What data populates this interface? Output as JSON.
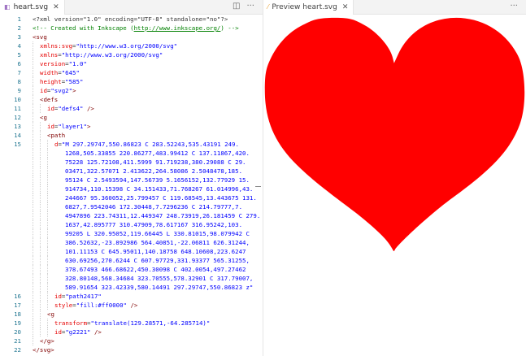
{
  "editor": {
    "tab_label": "heart.svg",
    "tab_icon": "svg-file-icon",
    "close_glyph": "✕",
    "split_glyph": "◫",
    "more_glyph": "···",
    "lines": [
      {
        "n": "1",
        "segs": [
          [
            "plain",
            "<?xml version=\"1.0\" encoding=\"UTF-8\" standalone=\"no\"?>"
          ]
        ]
      },
      {
        "n": "2",
        "segs": [
          [
            "cmt",
            "<!-- Created with Inkscape ("
          ],
          [
            "cmt link",
            "http://www.inkscape.org/"
          ],
          [
            "cmt",
            ") -->"
          ]
        ]
      },
      {
        "n": "3",
        "segs": [
          [
            "tag",
            "<svg"
          ]
        ]
      },
      {
        "n": "4",
        "segs": [
          [
            "attr",
            "xmlns:svg"
          ],
          [
            "plain",
            "="
          ],
          [
            "str",
            "\"http://www.w3.org/2000/svg\""
          ]
        ]
      },
      {
        "n": "5",
        "segs": [
          [
            "attr",
            "xmlns"
          ],
          [
            "plain",
            "="
          ],
          [
            "str",
            "\"http://www.w3.org/2000/svg\""
          ]
        ]
      },
      {
        "n": "6",
        "segs": [
          [
            "attr",
            "version"
          ],
          [
            "plain",
            "="
          ],
          [
            "str",
            "\"1.0\""
          ]
        ]
      },
      {
        "n": "7",
        "segs": [
          [
            "attr",
            "width"
          ],
          [
            "plain",
            "="
          ],
          [
            "str",
            "\"645\""
          ]
        ]
      },
      {
        "n": "8",
        "segs": [
          [
            "attr",
            "height"
          ],
          [
            "plain",
            "="
          ],
          [
            "str",
            "\"585\""
          ]
        ]
      },
      {
        "n": "9",
        "segs": [
          [
            "attr",
            "id"
          ],
          [
            "plain",
            "="
          ],
          [
            "str",
            "\"svg2\""
          ],
          [
            "tag",
            ">"
          ]
        ]
      },
      {
        "n": "10",
        "segs": [
          [
            "tag",
            "<defs"
          ]
        ]
      },
      {
        "n": "11",
        "segs": [
          [
            "attr",
            "id"
          ],
          [
            "plain",
            "="
          ],
          [
            "str",
            "\"defs4\""
          ],
          [
            "tag",
            " />"
          ]
        ]
      },
      {
        "n": "12",
        "segs": [
          [
            "tag",
            "<g"
          ]
        ]
      },
      {
        "n": "13",
        "segs": [
          [
            "attr",
            "id"
          ],
          [
            "plain",
            "="
          ],
          [
            "str",
            "\"layer1\""
          ],
          [
            "tag",
            ">"
          ]
        ]
      },
      {
        "n": "14",
        "segs": [
          [
            "tag",
            "<path"
          ]
        ]
      },
      {
        "n": "15",
        "segs": [
          [
            "attr",
            "d"
          ],
          [
            "plain",
            "="
          ],
          [
            "str",
            "\"M 297.29747,550.86823 C 283.52243,535.43191 249."
          ]
        ]
      },
      {
        "n": "",
        "segs": [
          [
            "str",
            "1268,505.33855 220.86277,483.99412 C 137.11867,420."
          ]
        ]
      },
      {
        "n": "",
        "segs": [
          [
            "str",
            "75228 125.72108,411.5999 91.719238,380.29088 C 29."
          ]
        ]
      },
      {
        "n": "",
        "segs": [
          [
            "str",
            "03471,322.57071 2.413622,264.58086 2.5048478,185."
          ]
        ]
      },
      {
        "n": "",
        "segs": [
          [
            "str",
            "95124 C 2.5493594,147.56739 5.1656152,132.77929 15."
          ]
        ]
      },
      {
        "n": "",
        "segs": [
          [
            "str",
            "914734,110.15398 C 34.151433,71.768267 61.014996,43."
          ]
        ]
      },
      {
        "n": "",
        "segs": [
          [
            "str",
            "244667 95.360052,25.799457 C 119.68545,13.443675 131."
          ]
        ]
      },
      {
        "n": "",
        "segs": [
          [
            "str",
            "6827,7.9542046 172.30448,7.7296236 C 214.79777,7."
          ]
        ]
      },
      {
        "n": "",
        "segs": [
          [
            "str",
            "4947896 223.74311,12.449347 248.73919,26.181459 C 279."
          ]
        ]
      },
      {
        "n": "",
        "segs": [
          [
            "str",
            "1637,42.895777 310.47909,78.617167 316.95242,103."
          ]
        ]
      },
      {
        "n": "",
        "segs": [
          [
            "str",
            "99205 L 320.95052,119.66445 L 330.81015,98.079942 C"
          ]
        ]
      },
      {
        "n": "",
        "segs": [
          [
            "str",
            "386.52632,-23.892986 564.40851,-22.06811 626.31244,"
          ]
        ]
      },
      {
        "n": "",
        "segs": [
          [
            "str",
            "101.11153 C 645.95011,140.18758 648.10608,223.6247"
          ]
        ]
      },
      {
        "n": "",
        "segs": [
          [
            "str",
            "630.69256,270.6244 C 607.97729,331.93377 565.31255,"
          ]
        ]
      },
      {
        "n": "",
        "segs": [
          [
            "str",
            "378.67493 466.68622,450.30098 C 402.0054,497.27462"
          ]
        ]
      },
      {
        "n": "",
        "segs": [
          [
            "str",
            "328.80148,568.34684 323.70555,578.32901 C 317.79007,"
          ]
        ]
      },
      {
        "n": "",
        "segs": [
          [
            "str",
            "589.91654 323.42339,580.14491 297.29747,550.86823 z\""
          ]
        ]
      },
      {
        "n": "16",
        "segs": [
          [
            "attr",
            "id"
          ],
          [
            "plain",
            "="
          ],
          [
            "str",
            "\"path2417\""
          ]
        ]
      },
      {
        "n": "17",
        "segs": [
          [
            "attr",
            "style"
          ],
          [
            "plain",
            "="
          ],
          [
            "str",
            "\"fill:#ff0000\""
          ],
          [
            "tag",
            " />"
          ]
        ]
      },
      {
        "n": "18",
        "segs": [
          [
            "tag",
            "<g"
          ]
        ]
      },
      {
        "n": "19",
        "segs": [
          [
            "attr",
            "transform"
          ],
          [
            "plain",
            "="
          ],
          [
            "str",
            "\"translate(129.28571,-64.285714)\""
          ]
        ]
      },
      {
        "n": "20",
        "segs": [
          [
            "attr",
            "id"
          ],
          [
            "plain",
            "="
          ],
          [
            "str",
            "\"g2221\""
          ],
          [
            "tag",
            " />"
          ]
        ]
      },
      {
        "n": "21",
        "segs": [
          [
            "tag",
            "</g>"
          ]
        ]
      },
      {
        "n": "22",
        "segs": [
          [
            "tag",
            "</svg>"
          ]
        ]
      }
    ]
  },
  "preview": {
    "tab_label": "Preview heart.svg",
    "tab_icon": "preview-icon",
    "close_glyph": "✕",
    "more_glyph": "···",
    "heart_fill": "#ff0000"
  },
  "colors": {
    "line_number": "#237893",
    "tag": "#800000",
    "attribute": "#e50000",
    "string": "#0000ff",
    "comment": "#008000"
  }
}
